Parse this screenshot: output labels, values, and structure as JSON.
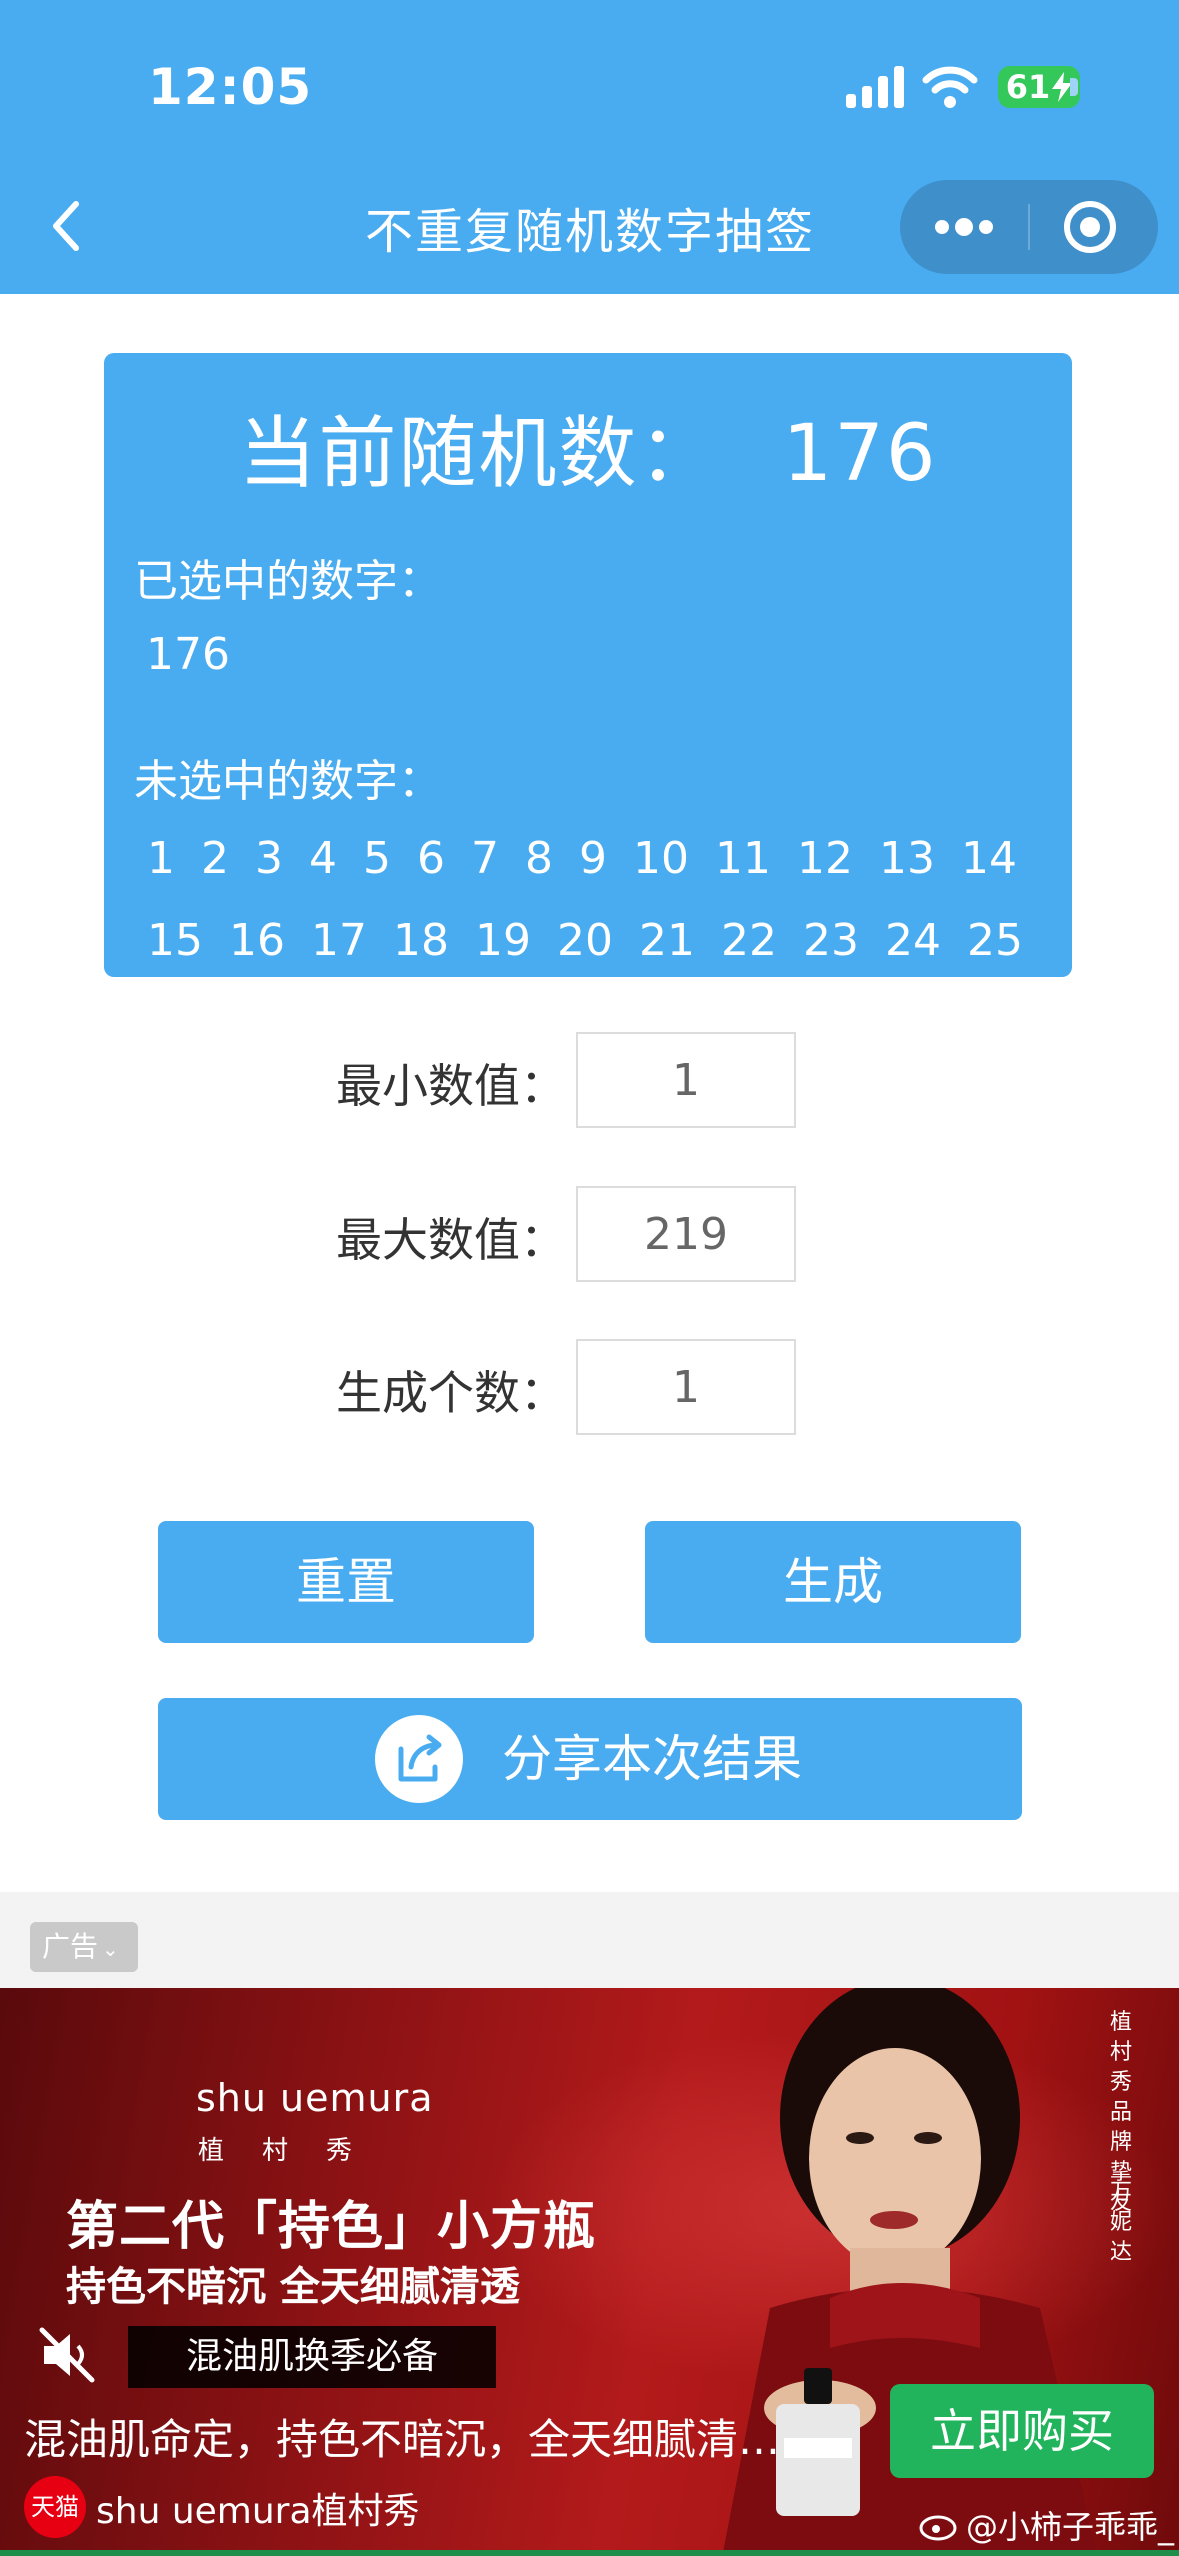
{
  "status_bar": {
    "time": "12:05",
    "battery": "61"
  },
  "nav": {
    "title": "不重复随机数字抽签"
  },
  "card": {
    "current_label": "当前随机数：",
    "current_value": "176",
    "selected_label": "已选中的数字：",
    "selected_values": "176",
    "unselected_label": "未选中的数字：",
    "unselected_numbers": [
      "1",
      "2",
      "3",
      "4",
      "5",
      "6",
      "7",
      "8",
      "9",
      "10",
      "11",
      "12",
      "13",
      "14",
      "15",
      "16",
      "17",
      "18",
      "19",
      "20",
      "21",
      "22",
      "23",
      "24",
      "25"
    ]
  },
  "form": {
    "min_label": "最小数值：",
    "min_value": "1",
    "max_label": "最大数值：",
    "max_value": "219",
    "count_label": "生成个数：",
    "count_value": "1"
  },
  "buttons": {
    "reset": "重置",
    "generate": "生成",
    "share": "分享本次结果"
  },
  "ad": {
    "tag": "广告",
    "brand": "shu uemura",
    "brand_cn": "植村秀",
    "headline": "第二代「持色」小方瓶",
    "subline": "持色不暗沉 全天细腻清透",
    "vertical_1": "植村秀品牌挚友",
    "vertical_2": "万妮达",
    "banner": "混油肌换季必备",
    "description": "混油肌命定，持色不暗沉，全天细腻清…",
    "cta": "立即购买",
    "platform": "天猫",
    "advertiser": "shu uemura植村秀"
  },
  "watermark": "@小柿子乖乖_",
  "colors": {
    "primary": "#4aacf0",
    "cta_green": "#22b45c",
    "battery_green": "#34c759"
  }
}
